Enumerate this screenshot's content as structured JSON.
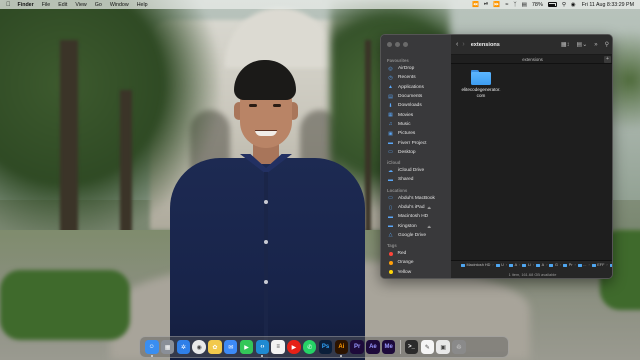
{
  "menubar": {
    "app_name": "Finder",
    "menus": [
      "File",
      "Edit",
      "View",
      "Go",
      "Window",
      "Help"
    ],
    "battery_percent": "78%",
    "clock": "Fri 11 Aug  8:33:29 PM",
    "status_icons": [
      "rewind-icon",
      "play-pause-icon",
      "forward-icon",
      "wifi-icon",
      "bluetooth-icon",
      "control-center-icon",
      "search-icon",
      "siri-icon"
    ]
  },
  "finder": {
    "title": "extensions",
    "tab_label": "extensions",
    "sidebar": {
      "favourites_header": "Favourites",
      "favourites": [
        {
          "label": "AirDrop",
          "icon": "airdrop-icon"
        },
        {
          "label": "Recents",
          "icon": "clock-icon"
        },
        {
          "label": "Applications",
          "icon": "applications-icon"
        },
        {
          "label": "Documents",
          "icon": "document-icon"
        },
        {
          "label": "Downloads",
          "icon": "download-icon"
        },
        {
          "label": "Movies",
          "icon": "film-icon"
        },
        {
          "label": "Music",
          "icon": "music-icon"
        },
        {
          "label": "Pictures",
          "icon": "pictures-icon"
        },
        {
          "label": "Fiverr Project",
          "icon": "folder-icon"
        },
        {
          "label": "Desktop",
          "icon": "desktop-icon"
        }
      ],
      "icloud_header": "iCloud",
      "icloud": [
        {
          "label": "iCloud Drive",
          "icon": "cloud-icon"
        },
        {
          "label": "Shared",
          "icon": "shared-folder-icon"
        }
      ],
      "locations_header": "Locations",
      "locations": [
        {
          "label": "Abdul's MacBook",
          "icon": "laptop-icon"
        },
        {
          "label": "Abdul's iPad",
          "icon": "ipad-icon",
          "eject": true
        },
        {
          "label": "Macintosh HD",
          "icon": "disk-icon"
        },
        {
          "label": "Kingston",
          "icon": "external-disk-icon",
          "eject": true
        },
        {
          "label": "Google Drive",
          "icon": "google-drive-icon"
        }
      ],
      "tags_header": "Tags",
      "tags": [
        {
          "label": "Red",
          "color": "#ff453a"
        },
        {
          "label": "Orange",
          "color": "#ff9f0a"
        },
        {
          "label": "Yellow",
          "color": "#ffd60a"
        }
      ]
    },
    "files": [
      {
        "name": "elitecodegenerator.com",
        "kind": "folder"
      }
    ],
    "path": [
      "Macintosh HD",
      "U",
      "A",
      "Li",
      "A",
      "G",
      "Pr",
      "...",
      "EFF",
      "extensions"
    ],
    "status": "1 item, 161.68 GB available"
  },
  "dock": {
    "apps": [
      {
        "name": "finder",
        "label": "",
        "color": "#3a8ef0",
        "running": true
      },
      {
        "name": "launchpad",
        "label": "",
        "color": "#8a8f98"
      },
      {
        "name": "safari",
        "label": "",
        "color": "#2f7fe8"
      },
      {
        "name": "chrome",
        "label": "",
        "color": "#e9e9e9"
      },
      {
        "name": "photos",
        "label": "",
        "color": "#f2c94c"
      },
      {
        "name": "mail",
        "label": "",
        "color": "#3d8af7"
      },
      {
        "name": "facetime",
        "label": "",
        "color": "#34c759"
      },
      {
        "name": "vscode",
        "label": "",
        "color": "#1f8ad2",
        "running": true
      },
      {
        "name": "notes",
        "label": "",
        "color": "#f2f2f2"
      },
      {
        "name": "youtube",
        "label": "",
        "color": "#e62117"
      },
      {
        "name": "whatsapp",
        "label": "",
        "color": "#25d366"
      },
      {
        "name": "photoshop",
        "label": "Ps",
        "color": "#0b1f3a",
        "text_color": "#31a8ff"
      },
      {
        "name": "illustrator",
        "label": "Ai",
        "color": "#2b1300",
        "text_color": "#ff9a00",
        "running": true
      },
      {
        "name": "premiere",
        "label": "Pr",
        "color": "#1d0a3a",
        "text_color": "#9999ff"
      },
      {
        "name": "after-effects",
        "label": "Ae",
        "color": "#1d0a3a",
        "text_color": "#9999ff"
      },
      {
        "name": "media-encoder",
        "label": "Me",
        "color": "#1d0a3a",
        "text_color": "#9999ff"
      }
    ],
    "right_apps": [
      {
        "name": "terminal",
        "label": "",
        "color": "#2b2b2b"
      },
      {
        "name": "textedit",
        "label": "",
        "color": "#f5f5f5"
      },
      {
        "name": "preview",
        "label": "",
        "color": "#e8e8e8"
      },
      {
        "name": "trash",
        "label": "",
        "color": "#8a8a8a"
      }
    ]
  }
}
